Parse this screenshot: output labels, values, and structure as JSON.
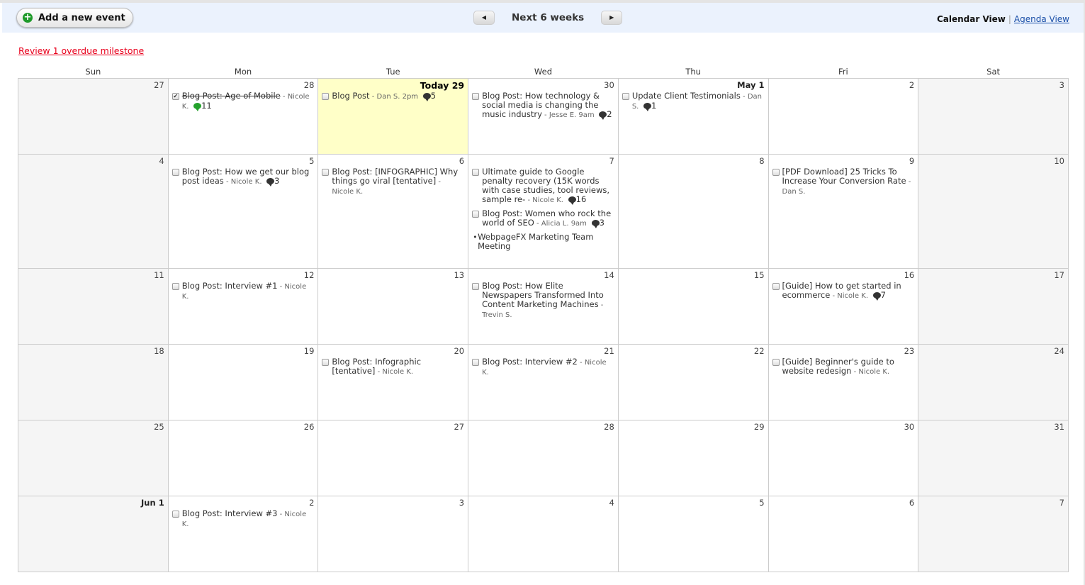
{
  "toolbar": {
    "add_event_label": "Add a new event",
    "range_label": "Next 6 weeks",
    "prev_icon": "triangle-left",
    "next_icon": "triangle-right",
    "calendar_view_label": "Calendar View",
    "separator": "|",
    "agenda_view_label": "Agenda View"
  },
  "overdue_link": "Review 1 overdue milestone",
  "colors": {
    "overdue": "#e8001c",
    "today_bg": "#ffffc8",
    "toolbar_bg": "#ebf2fd",
    "weekend_bg": "#f5f5f5",
    "add_icon": "#1f9a2a"
  },
  "weekdays": [
    "Sun",
    "Mon",
    "Tue",
    "Wed",
    "Thu",
    "Fri",
    "Sat"
  ],
  "weeks": [
    {
      "days": [
        {
          "label": "27"
        },
        {
          "label": "28",
          "events": [
            {
              "title": "Blog Post: Age of Mobile",
              "author": "Nicole K.",
              "comments": "11",
              "done": true,
              "comment_color": "green"
            }
          ]
        },
        {
          "label": "Today 29",
          "today": true,
          "events": [
            {
              "title": "Blog Post",
              "author": "Dan S.",
              "time": "2pm",
              "comments": "5"
            }
          ]
        },
        {
          "label": "30",
          "events": [
            {
              "title": "Blog Post: How technology & social media is changing the music industry",
              "author": "Jesse E.",
              "time": "9am",
              "comments": "2"
            }
          ]
        },
        {
          "label": "May 1",
          "bold": true,
          "events": [
            {
              "title": "Update Client Testimonials",
              "author": "Dan S.",
              "comments": "1"
            }
          ]
        },
        {
          "label": "2"
        },
        {
          "label": "3"
        }
      ]
    },
    {
      "days": [
        {
          "label": "4"
        },
        {
          "label": "5",
          "events": [
            {
              "title": "Blog Post: How we get our blog post ideas",
              "author": "Nicole K.",
              "comments": "3"
            }
          ]
        },
        {
          "label": "6",
          "events": [
            {
              "title": "Blog Post: [INFOGRAPHIC] Why things go viral [tentative]",
              "author": "Nicole K."
            }
          ]
        },
        {
          "label": "7",
          "events": [
            {
              "title": "Ultimate guide to Google penalty recovery (15K words with case studies, tool reviews, sample re-",
              "author": "Nicole K.",
              "comments": "16"
            },
            {
              "title": "Blog Post: Women who rock the world of SEO",
              "author": "Alicia L.",
              "time": "9am",
              "comments": "3"
            },
            {
              "title": "WebpageFX Marketing Team Meeting",
              "bullet": true
            }
          ]
        },
        {
          "label": "8"
        },
        {
          "label": "9",
          "events": [
            {
              "title": "[PDF Download] 25 Tricks To Increase Your Conversion Rate",
              "author": "Dan S."
            }
          ]
        },
        {
          "label": "10"
        }
      ]
    },
    {
      "days": [
        {
          "label": "11"
        },
        {
          "label": "12",
          "events": [
            {
              "title": "Blog Post: Interview #1",
              "author": "Nicole K."
            }
          ]
        },
        {
          "label": "13"
        },
        {
          "label": "14",
          "events": [
            {
              "title": "Blog Post: How Elite Newspapers Transformed Into Content Marketing Machines",
              "author": "Trevin S."
            }
          ]
        },
        {
          "label": "15"
        },
        {
          "label": "16",
          "events": [
            {
              "title": "[Guide] How to get started in ecommerce",
              "author": "Nicole K.",
              "comments": "7"
            }
          ]
        },
        {
          "label": "17"
        }
      ]
    },
    {
      "days": [
        {
          "label": "18"
        },
        {
          "label": "19"
        },
        {
          "label": "20",
          "events": [
            {
              "title": "Blog Post: Infographic [tentative]",
              "author": "Nicole K."
            }
          ]
        },
        {
          "label": "21",
          "events": [
            {
              "title": "Blog Post: Interview #2",
              "author": "Nicole K."
            }
          ]
        },
        {
          "label": "22"
        },
        {
          "label": "23",
          "events": [
            {
              "title": "[Guide] Beginner's guide to website redesign",
              "author": "Nicole K."
            }
          ]
        },
        {
          "label": "24"
        }
      ]
    },
    {
      "days": [
        {
          "label": "25"
        },
        {
          "label": "26"
        },
        {
          "label": "27"
        },
        {
          "label": "28"
        },
        {
          "label": "29"
        },
        {
          "label": "30"
        },
        {
          "label": "31"
        }
      ]
    },
    {
      "days": [
        {
          "label": "Jun 1",
          "bold": true
        },
        {
          "label": "2",
          "events": [
            {
              "title": "Blog Post: Interview #3",
              "author": "Nicole K."
            }
          ]
        },
        {
          "label": "3"
        },
        {
          "label": "4"
        },
        {
          "label": "5"
        },
        {
          "label": "6"
        },
        {
          "label": "7"
        }
      ]
    }
  ]
}
